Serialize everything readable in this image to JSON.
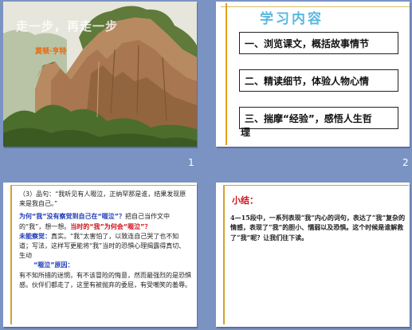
{
  "slides": [
    {
      "number": "1",
      "title": "走一步，再走一步",
      "author": "莫顿·亨特"
    },
    {
      "number": "2",
      "heading": "学习内容",
      "items": [
        "一、浏览课文，概括故事情节",
        "二、精读细节，体验人物心情",
        "三、揣摩“经验”，感悟人生哲"
      ],
      "overflow": "理"
    },
    {
      "number": "",
      "paragraph_intro": "（3）品句：“我听见有人啜泣，正纳罕那是谁，结果发现原来是我自己。”",
      "question1": "为何“我”没有察觉到自己在“啜泣”？",
      "q1_rest": "把自己当作文中的“我”，想一想。",
      "question2": "当时的“我”为何会“啜泣”？",
      "label_unaware": "未能察觉：",
      "unaware_text": "真实。“我”太害怕了，以致连自己哭了也不知道；写法，这样写更能将“我”当时的恐惧心理揭露得真切、生动",
      "label_reason": "“啜泣”原因：",
      "reason_text": "有不知所措的迷惘，有不该冒险的悔意，然而最强烈的是恐惧感。伙伴们都走了，这里有被抛弃的委屈，有受嘲笑的羞辱。"
    },
    {
      "number": "",
      "label": "小结：",
      "summary": "4—15段中，一系列表现“我”内心的词句，表达了“我”复杂的情感，表现了“我”的胆小、懦弱以及恐惧。这个时候是谁解救了“我”呢？让我们往下读。"
    }
  ]
}
